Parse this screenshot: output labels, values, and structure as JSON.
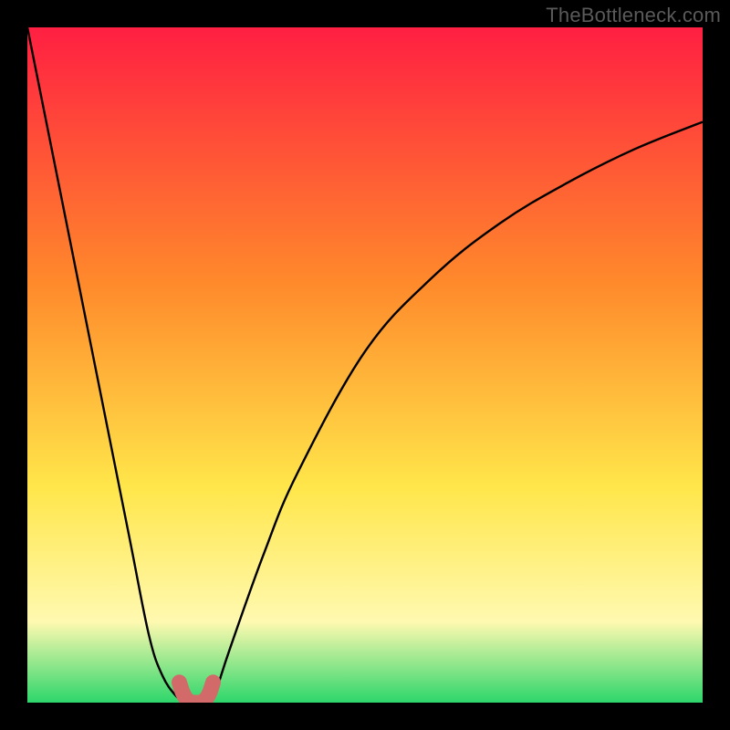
{
  "watermark": "TheBottleneck.com",
  "colors": {
    "background": "#000000",
    "gradient_top": "#ff1f42",
    "gradient_mid1": "#ff8a2b",
    "gradient_mid2": "#ffe64a",
    "gradient_mid3": "#fff9b0",
    "gradient_bottom": "#2dd66b",
    "curve": "#000000",
    "marker": "#d36a6a"
  },
  "chart_data": {
    "type": "line",
    "title": "",
    "xlabel": "",
    "ylabel": "",
    "xlim": [
      0,
      100
    ],
    "ylim": [
      0,
      100
    ],
    "series": [
      {
        "name": "bottleneck-curve",
        "x": [
          0,
          5,
          10,
          15,
          18,
          20,
          22,
          23,
          24,
          25,
          26,
          27,
          28,
          30,
          35,
          40,
          50,
          60,
          70,
          80,
          90,
          100
        ],
        "values": [
          100,
          75,
          50,
          25,
          10,
          4,
          1,
          0.5,
          0,
          0,
          0,
          0.5,
          2,
          8,
          22,
          34,
          52,
          63,
          71,
          77,
          82,
          86
        ]
      }
    ],
    "highlight": {
      "name": "optimal-range",
      "x": [
        22.5,
        23,
        23.5,
        24,
        24.5,
        25,
        25.5,
        26,
        26.5,
        27,
        27.5
      ],
      "values": [
        3,
        1.5,
        0.6,
        0.2,
        0,
        0,
        0,
        0.2,
        0.6,
        1.5,
        3
      ]
    }
  }
}
